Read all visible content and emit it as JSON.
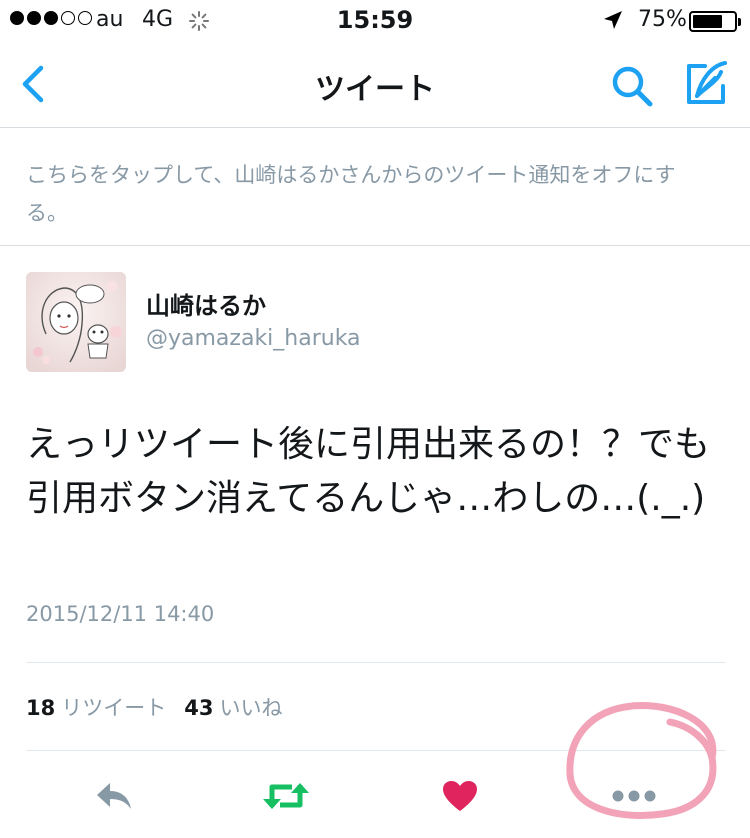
{
  "status_bar": {
    "carrier": "au",
    "network": "4G",
    "time": "15:59",
    "battery_percent": "75%",
    "battery_level": 0.75,
    "signal_bars_filled": 3,
    "signal_bars_total": 5
  },
  "nav": {
    "title": "ツイート",
    "back_icon": "chevron-left-icon",
    "search_icon": "search-icon",
    "compose_icon": "compose-tweet-icon"
  },
  "notice": {
    "text": "こちらをタップして、山崎はるかさんからのツイート通知をオフにする。"
  },
  "tweet": {
    "author_name": "山崎はるか",
    "author_handle": "@yamazaki_haruka",
    "text": "えっリツイート後に引用出来るの！？でも引用ボタン消えてるんじゃ…わしの…(._.)",
    "timestamp": "2015/12/11 14:40",
    "retweet_count": "18",
    "retweet_label": "リツイート",
    "like_count": "43",
    "like_label": "いいね"
  },
  "actions": {
    "reply_icon": "reply-icon",
    "retweet_icon": "retweet-icon",
    "like_icon": "heart-icon",
    "more_icon": "more-dots-icon"
  },
  "colors": {
    "accent": "#1da1f2",
    "retweet": "#17bf63",
    "like": "#e0245e",
    "secondary_text": "#8899a6",
    "annotation": "#f2a3b8"
  }
}
